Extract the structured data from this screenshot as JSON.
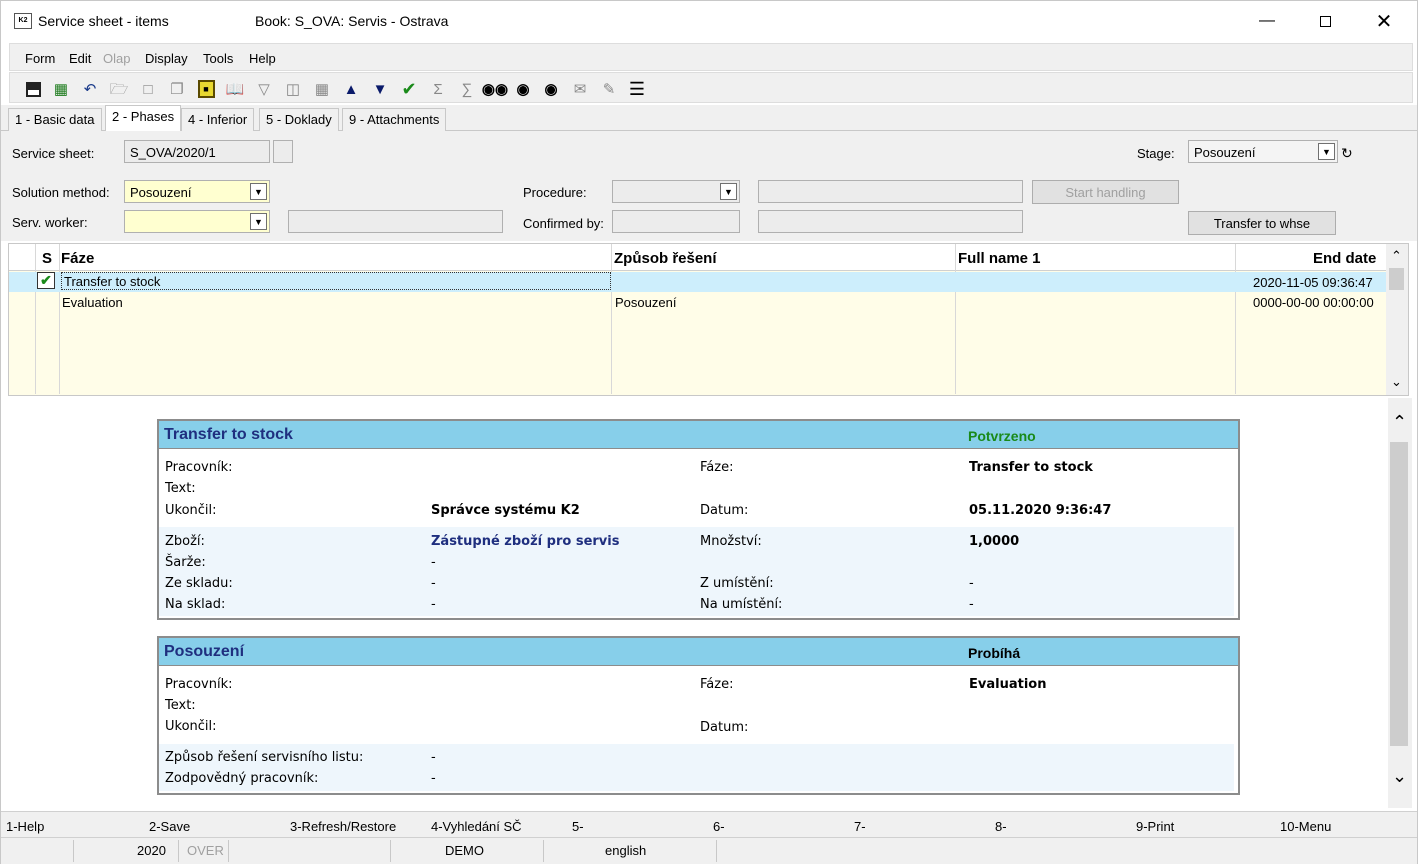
{
  "window": {
    "title": "Service sheet - items",
    "book": "Book: S_OVA: Servis - Ostrava",
    "app_icon": "k2-app-icon"
  },
  "menu": [
    "Form",
    "Edit",
    "Olap",
    "Display",
    "Tools",
    "Help"
  ],
  "menu_disabled": [
    "Olap"
  ],
  "toolbar_icons": [
    "save-icon",
    "save-close-icon",
    "undo-icon",
    "open-folder-icon",
    "new-document-icon",
    "copy-icon",
    "lock-icon",
    "book-icon",
    "filter-icon",
    "filter-doc-icon",
    "stack-icon",
    "arrow-up-icon",
    "arrow-down-icon",
    "check-icon",
    "sigma-icon",
    "sum-icon",
    "binoculars-icon",
    "binoculars-up-icon",
    "binoculars-down-icon",
    "envelope-icon",
    "edit-icon",
    "hamburger-icon"
  ],
  "tabs": [
    {
      "label": "1 - Basic data",
      "active": false
    },
    {
      "label": "2 - Phases",
      "active": true
    },
    {
      "label": "4 - Inferior",
      "active": false
    },
    {
      "label": "5 - Doklady",
      "active": false
    },
    {
      "label": "9 - Attachments",
      "active": false
    }
  ],
  "form": {
    "service_sheet_label": "Service sheet:",
    "service_sheet_value": "S_OVA/2020/1",
    "stage_label": "Stage:",
    "stage_value": "Posouzení",
    "solution_method_label": "Solution method:",
    "solution_method_value": "Posouzení",
    "serv_worker_label": "Serv. worker:",
    "serv_worker_value": "",
    "procedure_label": "Procedure:",
    "procedure_value": "",
    "confirmed_by_label": "Confirmed by:",
    "confirmed_by_value": "",
    "start_handling_label": "Start handling",
    "transfer_label": "Transfer to whse"
  },
  "grid": {
    "headers": [
      "S",
      "Fáze",
      "Způsob řešení",
      "Full name 1",
      "End date"
    ],
    "rows": [
      {
        "s": "checked",
        "faze": "Transfer to stock",
        "zpusob": "",
        "name": "",
        "end": "2020-11-05 09:36:47"
      },
      {
        "s": "",
        "faze": "Evaluation",
        "zpusob": "Posouzení",
        "name": "",
        "end": "0000-00-00 00:00:00"
      }
    ]
  },
  "cards": [
    {
      "title": "Transfer to stock",
      "status": "Potvrzeno",
      "status_color": "#1a8a1a",
      "pracovnik_label": "Pracovník:",
      "pracovnik_value": "",
      "faze_label": "Fáze:",
      "faze_value": "Transfer to stock",
      "text_label": "Text:",
      "ukoncil_label": "Ukončil:",
      "ukoncil_value": "Správce systému K2",
      "datum_label": "Datum:",
      "datum_value": "05.11.2020 9:36:47",
      "zbozi_label": "Zboží:",
      "zbozi_value": "Zástupné zboží pro servis",
      "mnozstvi_label": "Množství:",
      "mnozstvi_value": "1,0000",
      "sarze_label": "Šarže:",
      "sarze_value": "-",
      "ze_skladu_label": "Ze skladu:",
      "ze_skladu_value": "-",
      "z_umisteni_label": "Z umístění:",
      "z_umisteni_value": "-",
      "na_sklad_label": "Na sklad:",
      "na_sklad_value": "-",
      "na_umisteni_label": "Na umístění:",
      "na_umisteni_value": "-"
    },
    {
      "title": "Posouzení",
      "status": "Probíhá",
      "status_color": "#000000",
      "pracovnik_label": "Pracovník:",
      "faze_label": "Fáze:",
      "faze_value": "Evaluation",
      "text_label": "Text:",
      "ukoncil_label": "Ukončil:",
      "datum_label": "Datum:",
      "zpusob_label": "Způsob řešení servisního listu:",
      "zpusob_value": "-",
      "zodpovedny_label": "Zodpovědný pracovník:",
      "zodpovedny_value": "-"
    }
  ],
  "fkeys": [
    "1-Help",
    "2-Save",
    "3-Refresh/Restore",
    "4-Vyhledání SČ",
    "5-",
    "6-",
    "7-",
    "8-",
    "9-Print",
    "10-Menu"
  ],
  "status": {
    "year": "2020",
    "over": "OVER",
    "db": "DEMO",
    "lang": "english"
  }
}
